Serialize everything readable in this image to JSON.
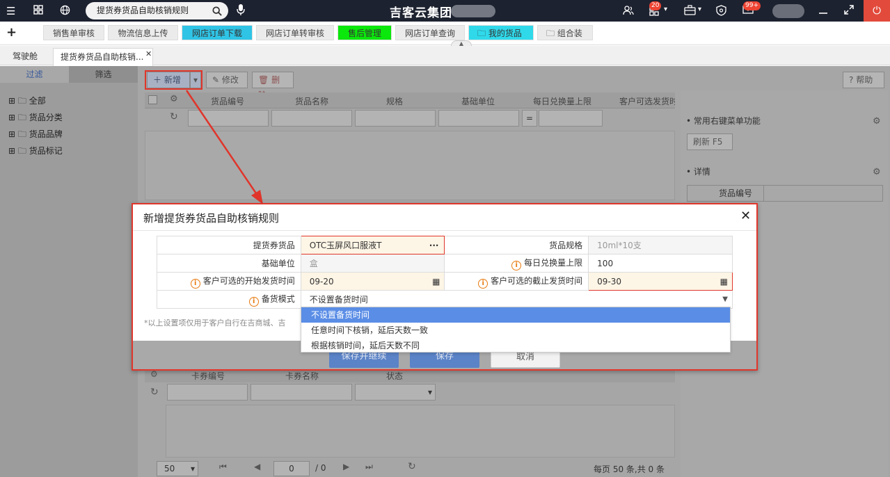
{
  "topbar": {
    "search_text": "提货券货品自助核销规则",
    "app_title": "吉客云集团",
    "notify_badge": "20",
    "mail_badge": "99+"
  },
  "quickbar": {
    "tabs": [
      {
        "label": "销售单审核"
      },
      {
        "label": "物流信息上传"
      },
      {
        "label": "网店订单下载"
      },
      {
        "label": "网店订单转审核"
      },
      {
        "label": "售后管理"
      },
      {
        "label": "网店订单查询"
      },
      {
        "label": "我的货品"
      },
      {
        "label": "组合装"
      }
    ]
  },
  "page_tabs": [
    {
      "label": "驾驶舱"
    },
    {
      "label": "提货券货品自助核销..."
    }
  ],
  "left_panel": {
    "tab_filter": "过滤",
    "tab_select": "筛选",
    "tree": [
      "全部",
      "货品分类",
      "货品品牌",
      "货品标记"
    ]
  },
  "toolbar": {
    "add_label": "新增",
    "edit_label": "修改",
    "delete_label": "删除",
    "help_label": "帮助"
  },
  "grid": {
    "headers": [
      "货品编号",
      "货品名称",
      "规格",
      "基础单位",
      "每日兑换量上限",
      "客户可选发货时"
    ],
    "operator": "="
  },
  "lower_grid": {
    "headers": [
      "卡券编号",
      "卡券名称",
      "状态"
    ],
    "page_size": "50",
    "page_input": "0",
    "page_total": "/ 0",
    "summary": "每页 50 条,共 0 条"
  },
  "right_panel": {
    "section1": "常用右键菜单功能",
    "refresh_btn": "刷新  F5",
    "section2": "详情",
    "detail_header": "货品编号"
  },
  "dialog": {
    "title": "新增提货券货品自助核销规则",
    "rows": {
      "product_label": "提货券货品",
      "product_value": "OTC玉屏风口服液T",
      "spec_label": "货品规格",
      "spec_value": "10ml*10支",
      "unit_label": "基础单位",
      "unit_value": "盒",
      "limit_label": "每日兑换量上限",
      "limit_value": "100",
      "start_label": "客户可选的开始发货时间",
      "start_value": "09-20",
      "end_label": "客户可选的截止发货时间",
      "end_value": "09-30",
      "mode_label": "备货模式",
      "mode_value": "不设置备货时间"
    },
    "note": "*以上设置项仅用于客户自行在吉商城、吉",
    "dropdown_options": [
      "不设置备货时间",
      "任意时间下核销，延后天数一致",
      "根据核销时间，延后天数不同"
    ],
    "btn_save_continue": "保存并继续",
    "btn_save": "保存",
    "btn_cancel": "取消"
  },
  "colors": {
    "topbar": "#1d2230",
    "accent_red": "#e0352b",
    "dropdown_selected": "#5a8de6",
    "btn_blue": "#5b83c7"
  }
}
